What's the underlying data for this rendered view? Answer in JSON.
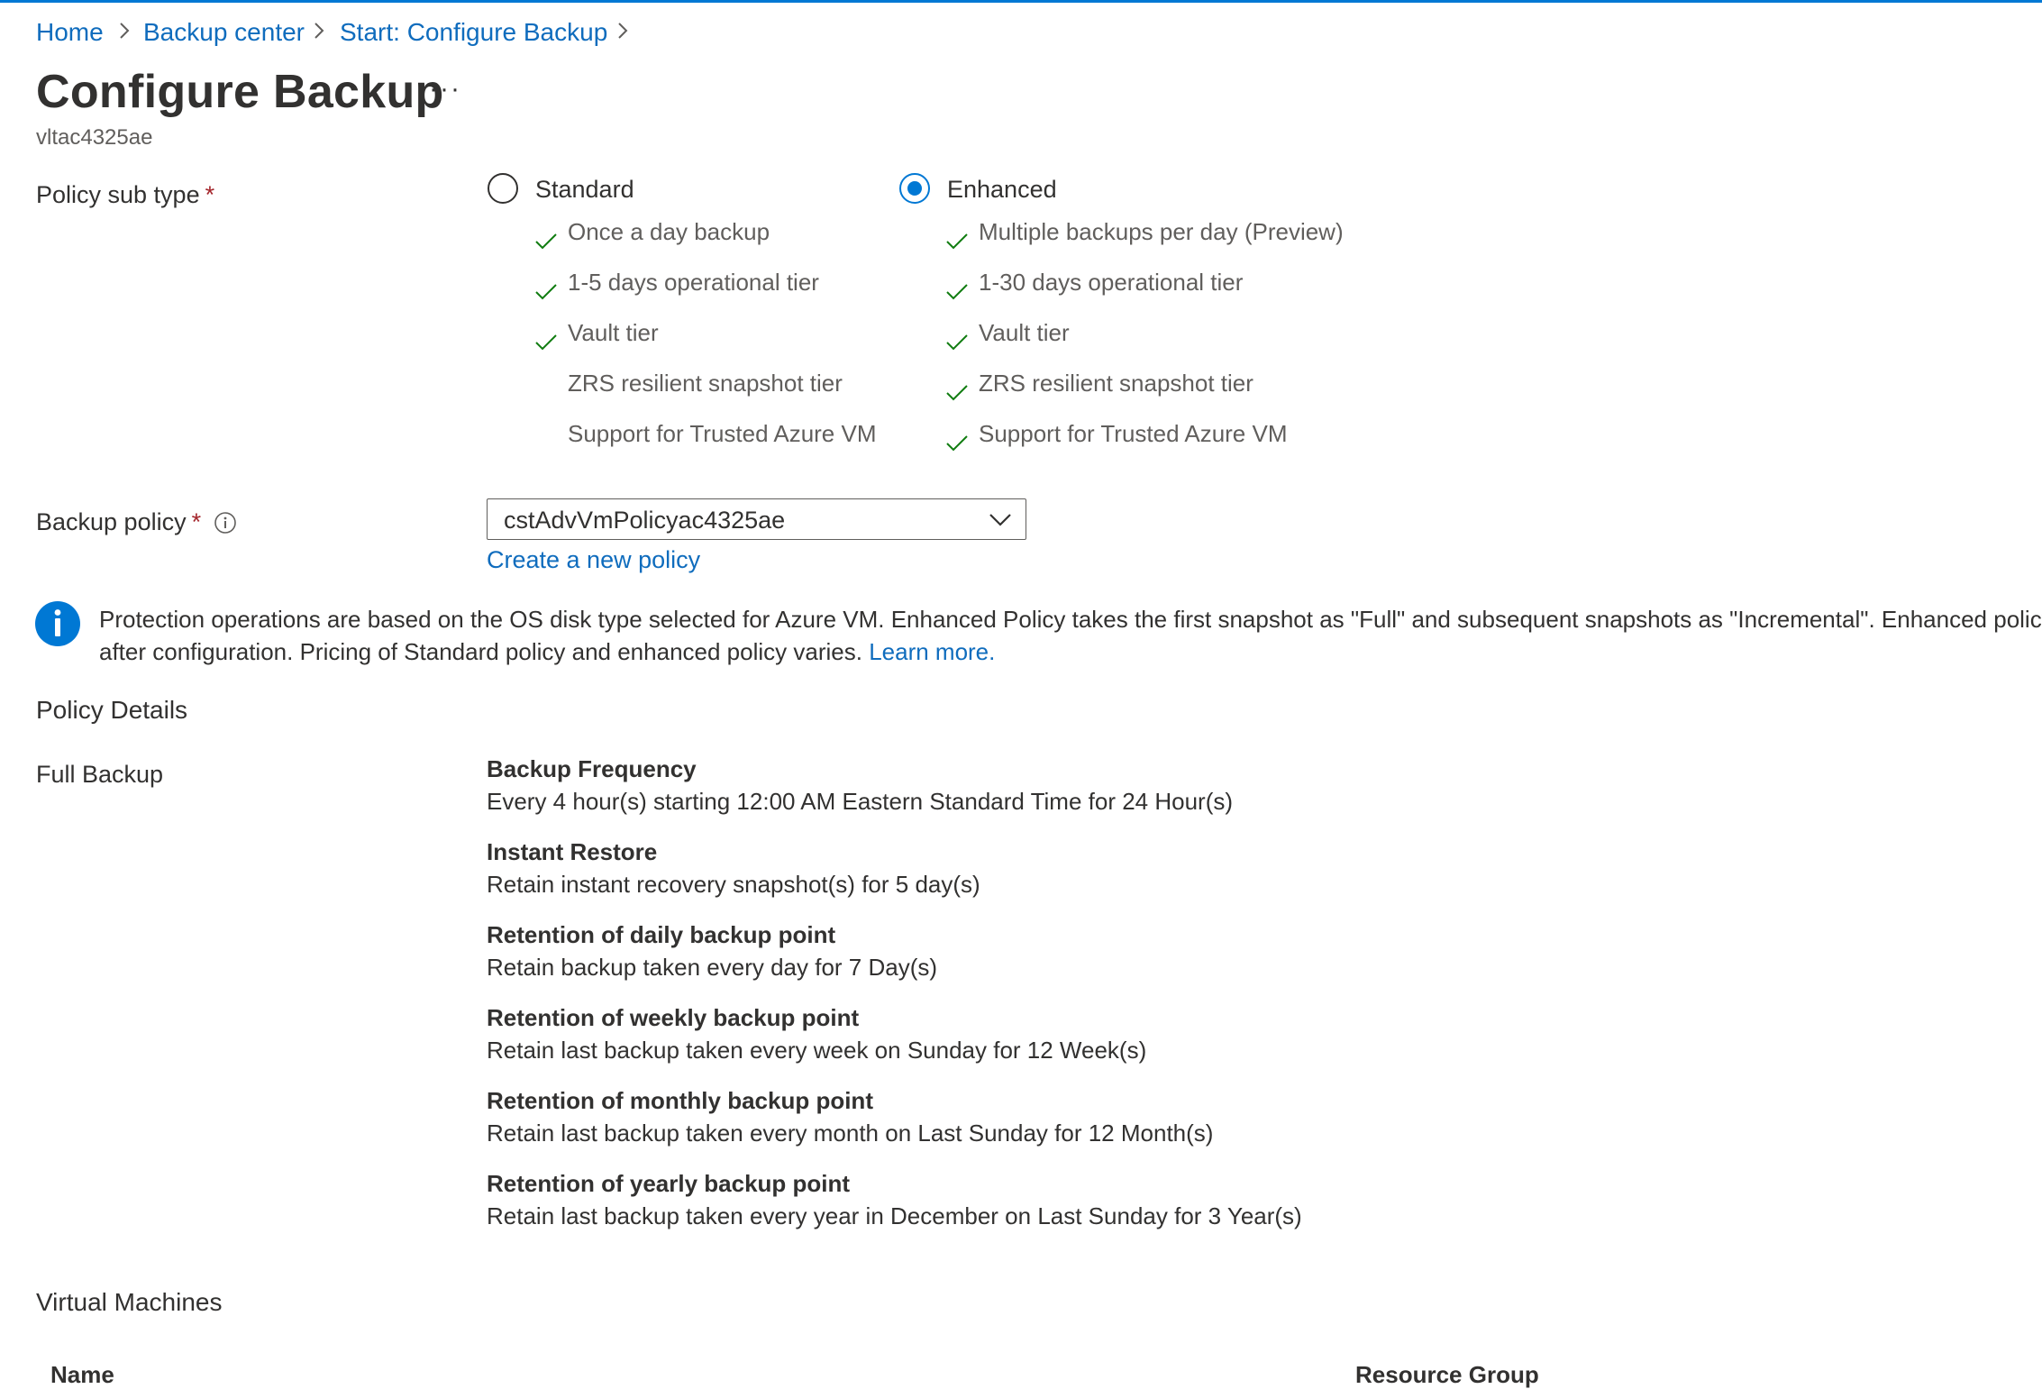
{
  "breadcrumb": {
    "items": [
      "Home",
      "Backup center",
      "Start: Configure Backup"
    ]
  },
  "header": {
    "title": "Configure Backup",
    "more_label": "···",
    "subtitle": "vltac4325ae"
  },
  "policy_sub_type": {
    "label": "Policy sub type",
    "required_mark": "*",
    "selected": "Enhanced",
    "options": [
      {
        "label": "Standard",
        "checked": false,
        "features": [
          {
            "text": "Once a day backup",
            "included": true
          },
          {
            "text": "1-5 days operational tier",
            "included": true
          },
          {
            "text": "Vault tier",
            "included": true
          },
          {
            "text": "ZRS resilient snapshot tier",
            "included": false
          },
          {
            "text": "Support for Trusted Azure VM",
            "included": false
          }
        ]
      },
      {
        "label": "Enhanced",
        "checked": true,
        "features": [
          {
            "text": "Multiple backups per day (Preview)",
            "included": true
          },
          {
            "text": "1-30 days operational tier",
            "included": true
          },
          {
            "text": "Vault tier",
            "included": true
          },
          {
            "text": "ZRS resilient snapshot tier",
            "included": true
          },
          {
            "text": "Support for Trusted Azure VM",
            "included": true
          }
        ]
      }
    ]
  },
  "backup_policy": {
    "label": "Backup policy",
    "required_mark": "*",
    "value": "cstAdvVmPolicyac4325ae",
    "create_link": "Create a new policy"
  },
  "info_banner": {
    "line1": "Protection operations are based on the OS disk type selected for Azure VM. Enhanced Policy takes the first snapshot as \"Full\" and subsequent snapshots as \"Incremental\". Enhanced policy h",
    "line2": "after configuration. Pricing of Standard policy and enhanced policy varies.",
    "learn_more": "Learn more."
  },
  "policy_details": {
    "heading": "Policy Details",
    "row_label": "Full Backup",
    "items": [
      {
        "title": "Backup Frequency",
        "value": "Every 4 hour(s) starting 12:00 AM Eastern Standard Time for 24 Hour(s)"
      },
      {
        "title": "Instant Restore",
        "value": "Retain instant recovery snapshot(s) for 5 day(s)"
      },
      {
        "title": "Retention of daily backup point",
        "value": "Retain backup taken every day for 7 Day(s)"
      },
      {
        "title": "Retention of weekly backup point",
        "value": "Retain last backup taken every week on Sunday for 12 Week(s)"
      },
      {
        "title": "Retention of monthly backup point",
        "value": "Retain last backup taken every month on Last Sunday for 12 Month(s)"
      },
      {
        "title": "Retention of yearly backup point",
        "value": "Retain last backup taken every year in December on Last Sunday for 3 Year(s)"
      }
    ]
  },
  "virtual_machines": {
    "heading": "Virtual Machines",
    "columns": [
      "Name",
      "Resource Group"
    ]
  },
  "colors": {
    "accent": "#0078d4",
    "link": "#0f6cbd",
    "check": "#107c10",
    "required": "#a4262c"
  }
}
